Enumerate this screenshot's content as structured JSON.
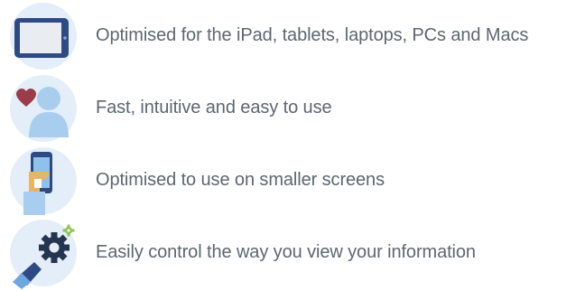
{
  "features": [
    {
      "icon": "tablet-icon",
      "text": "Optimised for the iPad, tablets, laptops, PCs and Macs"
    },
    {
      "icon": "user-heart-icon",
      "text": "Fast, intuitive and easy to use"
    },
    {
      "icon": "smartphone-hand-icon",
      "text": "Optimised to use on smaller screens"
    },
    {
      "icon": "gears-control-icon",
      "text": "Easily control the way you view your information"
    }
  ],
  "colors": {
    "icon_circle": "#e4eef8",
    "device_dark": "#2e4a82",
    "device_screen": "#e9edf2",
    "person": "#a9cdee",
    "heart": "#9b3c49",
    "hand_skin": "#e6b568",
    "gear": "#24364f",
    "gear_accent": "#8bc34a",
    "text": "#5b6770"
  }
}
